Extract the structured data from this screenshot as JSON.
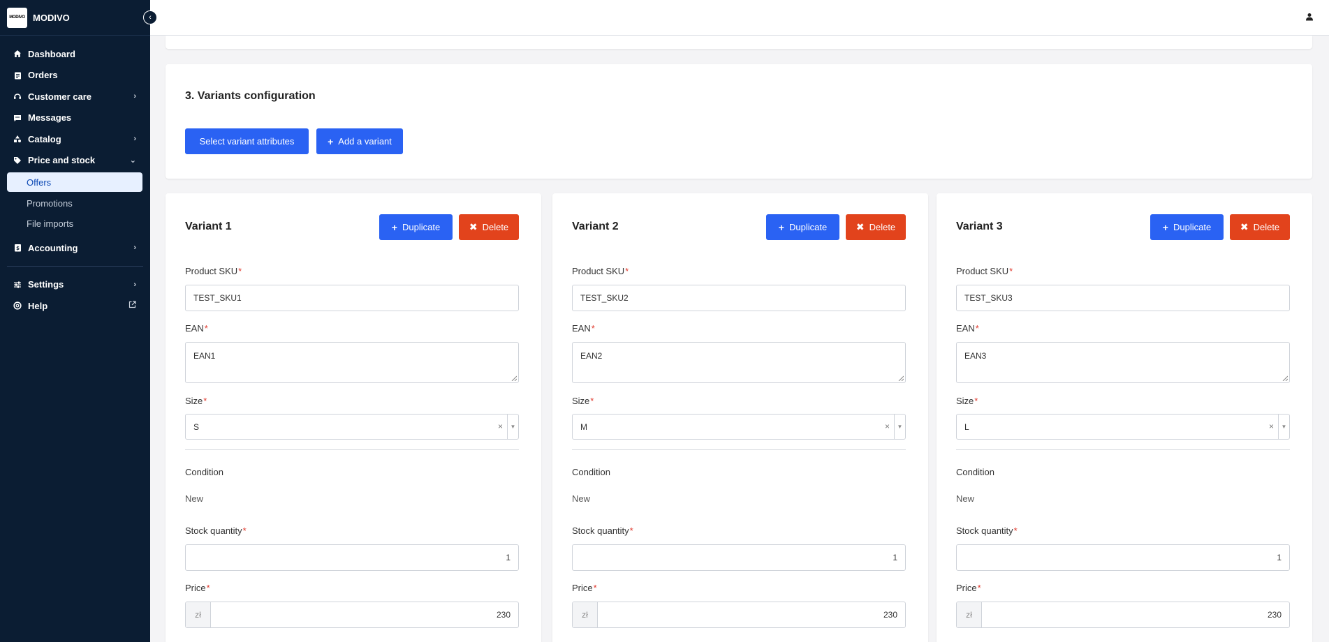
{
  "app": {
    "brand": "MODIVO",
    "logo_text": "MODIVO"
  },
  "sidebar": {
    "items": [
      {
        "label": "Dashboard",
        "icon": "home-icon"
      },
      {
        "label": "Orders",
        "icon": "clipboard-icon"
      },
      {
        "label": "Customer care",
        "icon": "headset-icon"
      },
      {
        "label": "Messages",
        "icon": "message-icon"
      },
      {
        "label": "Catalog",
        "icon": "shapes-icon"
      },
      {
        "label": "Price and stock",
        "icon": "tag-icon"
      },
      {
        "label": "Accounting",
        "icon": "invoice-icon"
      },
      {
        "label": "Settings",
        "icon": "sliders-icon"
      },
      {
        "label": "Help",
        "icon": "lifebuoy-icon"
      }
    ],
    "price_and_stock_sub": [
      "Offers",
      "Promotions",
      "File imports"
    ]
  },
  "section": {
    "title": "3. Variants configuration",
    "select_attributes_label": "Select variant attributes",
    "add_variant_label": "Add a variant"
  },
  "labels": {
    "duplicate": "Duplicate",
    "delete": "Delete",
    "sku": "Product SKU",
    "ean": "EAN",
    "size": "Size",
    "condition": "Condition",
    "stock": "Stock quantity",
    "price": "Price",
    "required": "*",
    "currency": "zł"
  },
  "variants": [
    {
      "title": "Variant 1",
      "sku": "TEST_SKU1",
      "ean": "EAN1",
      "size": "S",
      "condition": "New",
      "stock": "1",
      "price": "230"
    },
    {
      "title": "Variant 2",
      "sku": "TEST_SKU2",
      "ean": "EAN2",
      "size": "M",
      "condition": "New",
      "stock": "1",
      "price": "230"
    },
    {
      "title": "Variant 3",
      "sku": "TEST_SKU3",
      "ean": "EAN3",
      "size": "L",
      "condition": "New",
      "stock": "1",
      "price": "230"
    }
  ],
  "colors": {
    "sidebar": "#0b1d33",
    "primary": "#2a62f3",
    "danger": "#e2431c",
    "required": "#e03a2e",
    "active_bg": "#e7f0ff"
  }
}
